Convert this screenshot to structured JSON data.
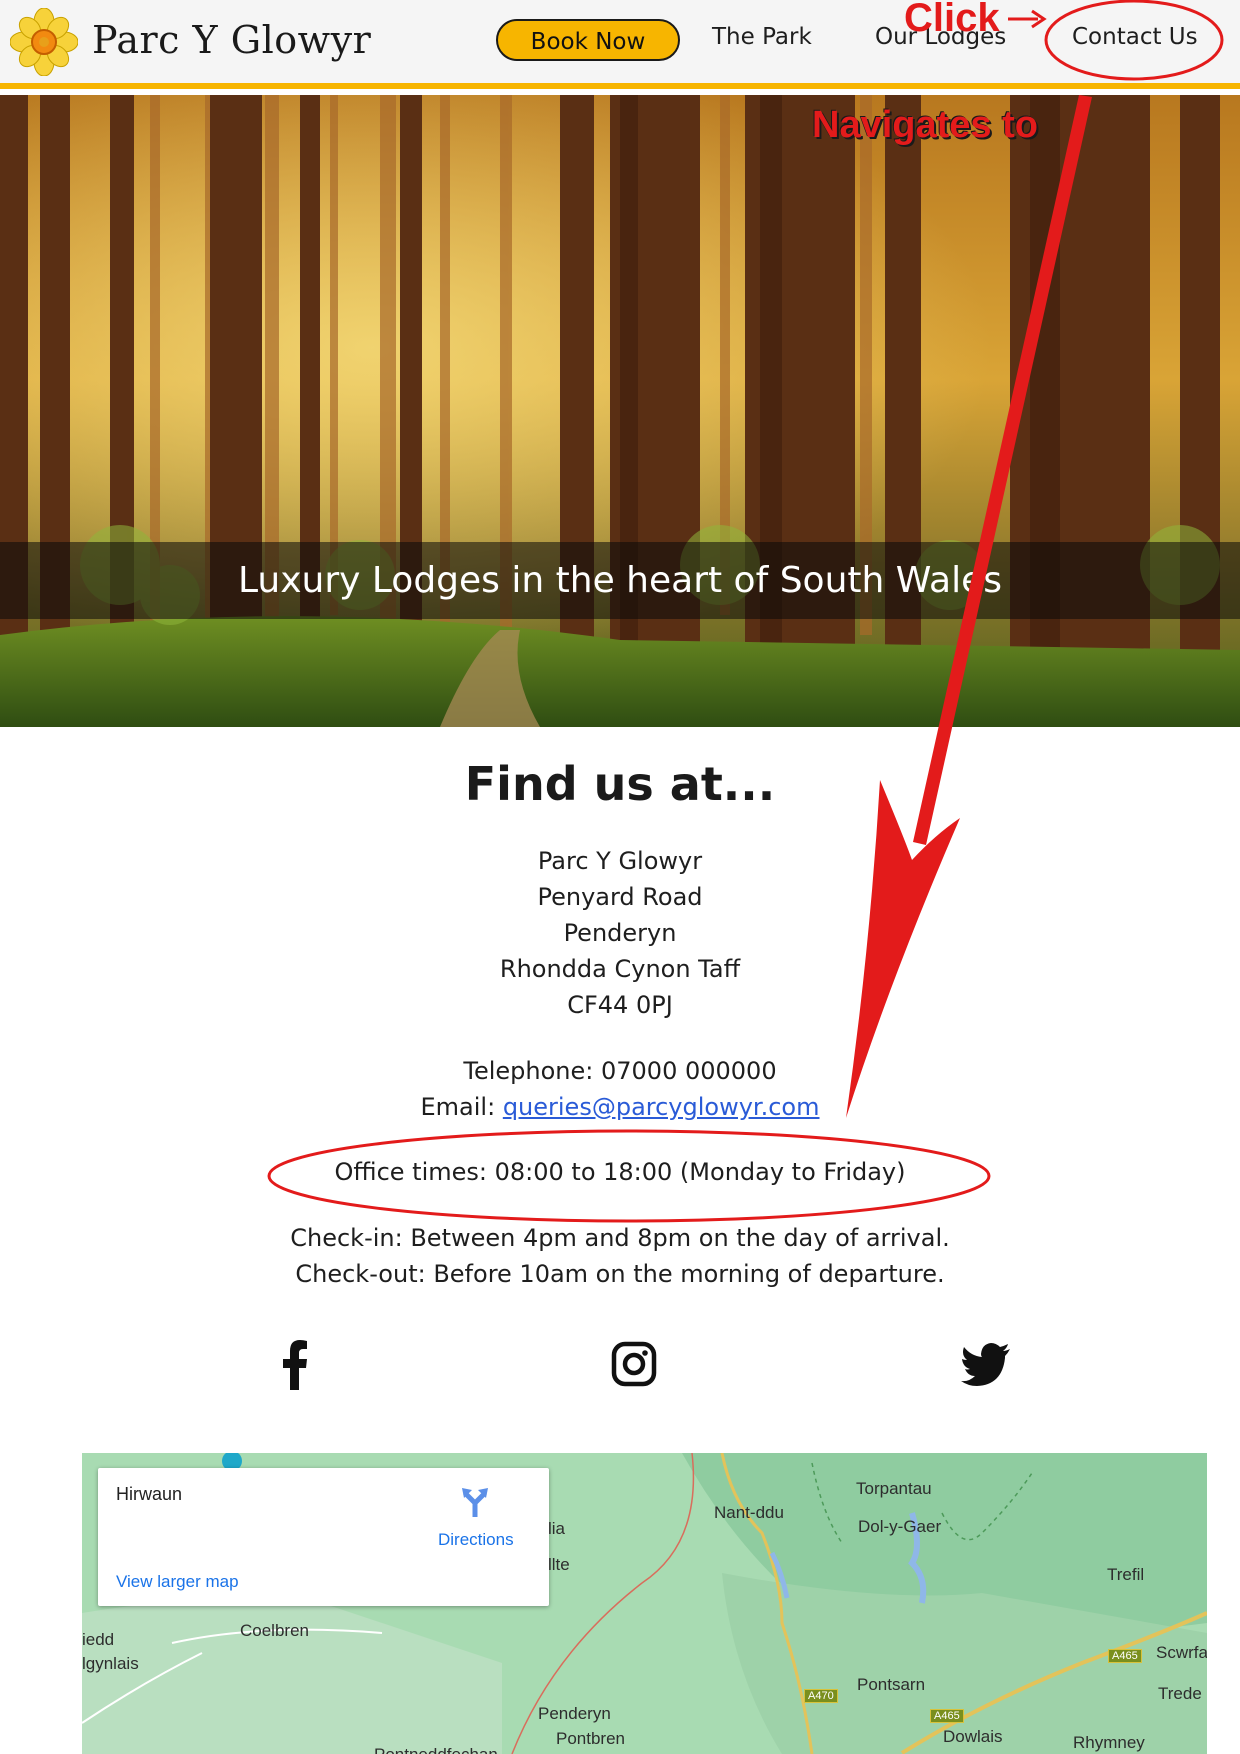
{
  "header": {
    "brand": "Parc Y Glowyr",
    "book_label": "Book Now",
    "nav": [
      "The Park",
      "Our Lodges",
      "Contact Us"
    ]
  },
  "hero": {
    "caption": "Luxury Lodges in the heart of South Wales"
  },
  "contact": {
    "title": "Find us at...",
    "address": [
      "Parc Y Glowyr",
      "Penyard Road",
      "Penderyn",
      "Rhondda Cynon Taff",
      "CF44 0PJ"
    ],
    "telephone": "Telephone: 07000 000000",
    "email_label": "Email: ",
    "email": "queries@parcyglowyr.com",
    "office_times": "Office times: 08:00 to 18:00 (Monday to Friday)",
    "checkin": "Check-in: Between 4pm and 8pm on the day of arrival.",
    "checkout": "Check-out: Before 10am on the morning of departure."
  },
  "social": [
    "facebook-icon",
    "instagram-icon",
    "twitter-icon"
  ],
  "map": {
    "place": "Hirwaun",
    "directions": "Directions",
    "view_larger": "View larger map",
    "labels": [
      "Torpantau",
      "Nant-ddu",
      "Dol-y-Gaer",
      "Trefil",
      "Coelbren",
      "Pontsarn",
      "Penderyn",
      "Pontbren",
      "Dowlais",
      "Rhymney",
      "Scwrfa",
      "Trede",
      "iedd",
      "lgynlais",
      "lia",
      "llte",
      "Pontneddfechan"
    ],
    "roads": [
      "A465",
      "A470",
      "A465"
    ]
  },
  "annotations": {
    "click": "Click",
    "navigates": "Navigates to"
  },
  "colors": {
    "accent": "#f7b500",
    "annotation": "#e31b1b",
    "link": "#2a5bd7"
  }
}
